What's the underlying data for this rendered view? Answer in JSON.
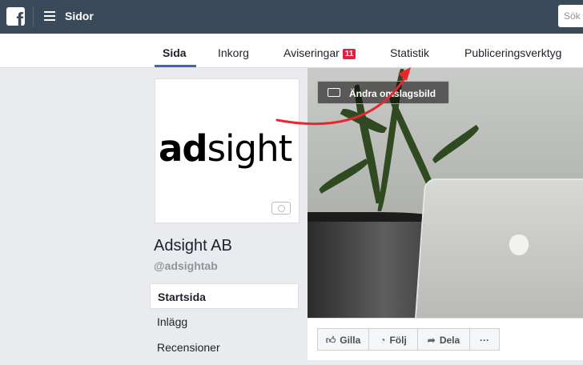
{
  "topbar": {
    "title": "Sidor",
    "search_placeholder": "Sök"
  },
  "tabs": [
    {
      "label": "Sida"
    },
    {
      "label": "Inkorg"
    },
    {
      "label": "Aviseringar",
      "badge": "11"
    },
    {
      "label": "Statistik"
    },
    {
      "label": "Publiceringsverktyg"
    }
  ],
  "profile": {
    "logo_bold": "ad",
    "logo_light": "sight",
    "name": "Adsight AB",
    "handle": "@adsightab"
  },
  "side_nav": [
    {
      "label": "Startsida"
    },
    {
      "label": "Inlägg"
    },
    {
      "label": "Recensioner"
    }
  ],
  "cover": {
    "change_button": "Ändra omslagsbild"
  },
  "actions": {
    "like": "Gilla",
    "follow": "Följ",
    "share": "Dela",
    "more": "···"
  },
  "colors": {
    "topbar": "#3b4a5a",
    "accent": "#4267b2",
    "badge": "#e41e3f",
    "annotation_arrow": "#e8262d"
  }
}
